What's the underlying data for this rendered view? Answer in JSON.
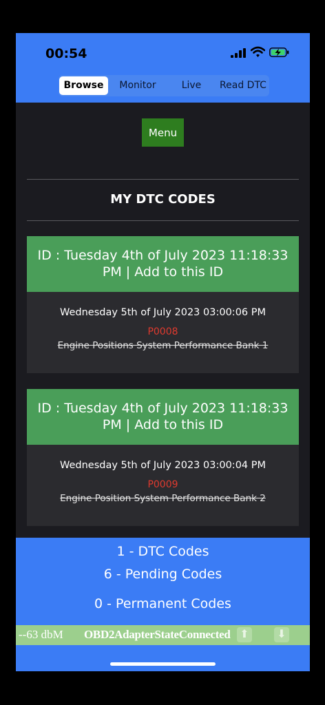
{
  "status": {
    "time": "00:54"
  },
  "tabs": [
    {
      "label": "Browse"
    },
    {
      "label": "Monitor"
    },
    {
      "label": "Live"
    },
    {
      "label": "Read DTC"
    }
  ],
  "menu": {
    "label": "Menu"
  },
  "page_title": "MY DTC CODES",
  "cards": [
    {
      "header": "ID : Tuesday 4th of July 2023 11:18:33 PM | Add to this ID",
      "date": "Wednesday 5th of July 2023 03:00:06 PM",
      "code": "P0008",
      "description": "Engine Positions System Performance Bank 1"
    },
    {
      "header": "ID : Tuesday 4th of July 2023 11:18:33 PM | Add to this ID",
      "date": "Wednesday 5th of July 2023 03:00:04 PM",
      "code": "P0009",
      "description": "Engine Position System Performance Bank 2"
    }
  ],
  "summary": {
    "dtc": "1 - DTC Codes",
    "pending": "6 - Pending Codes",
    "permanent": "0 - Permanent Codes"
  },
  "adapter": {
    "signal": "--63 dbM",
    "state": "OBD2AdapterStateConnected"
  },
  "colors": {
    "accent": "#3b7cf5",
    "header_green": "#4a9e59",
    "menu_green": "#2e7d1f",
    "code_red": "#e03a2f"
  },
  "icons": [
    "signal-icon",
    "wifi-icon",
    "battery-charging-icon",
    "arrow-up-icon",
    "arrow-down-icon"
  ]
}
